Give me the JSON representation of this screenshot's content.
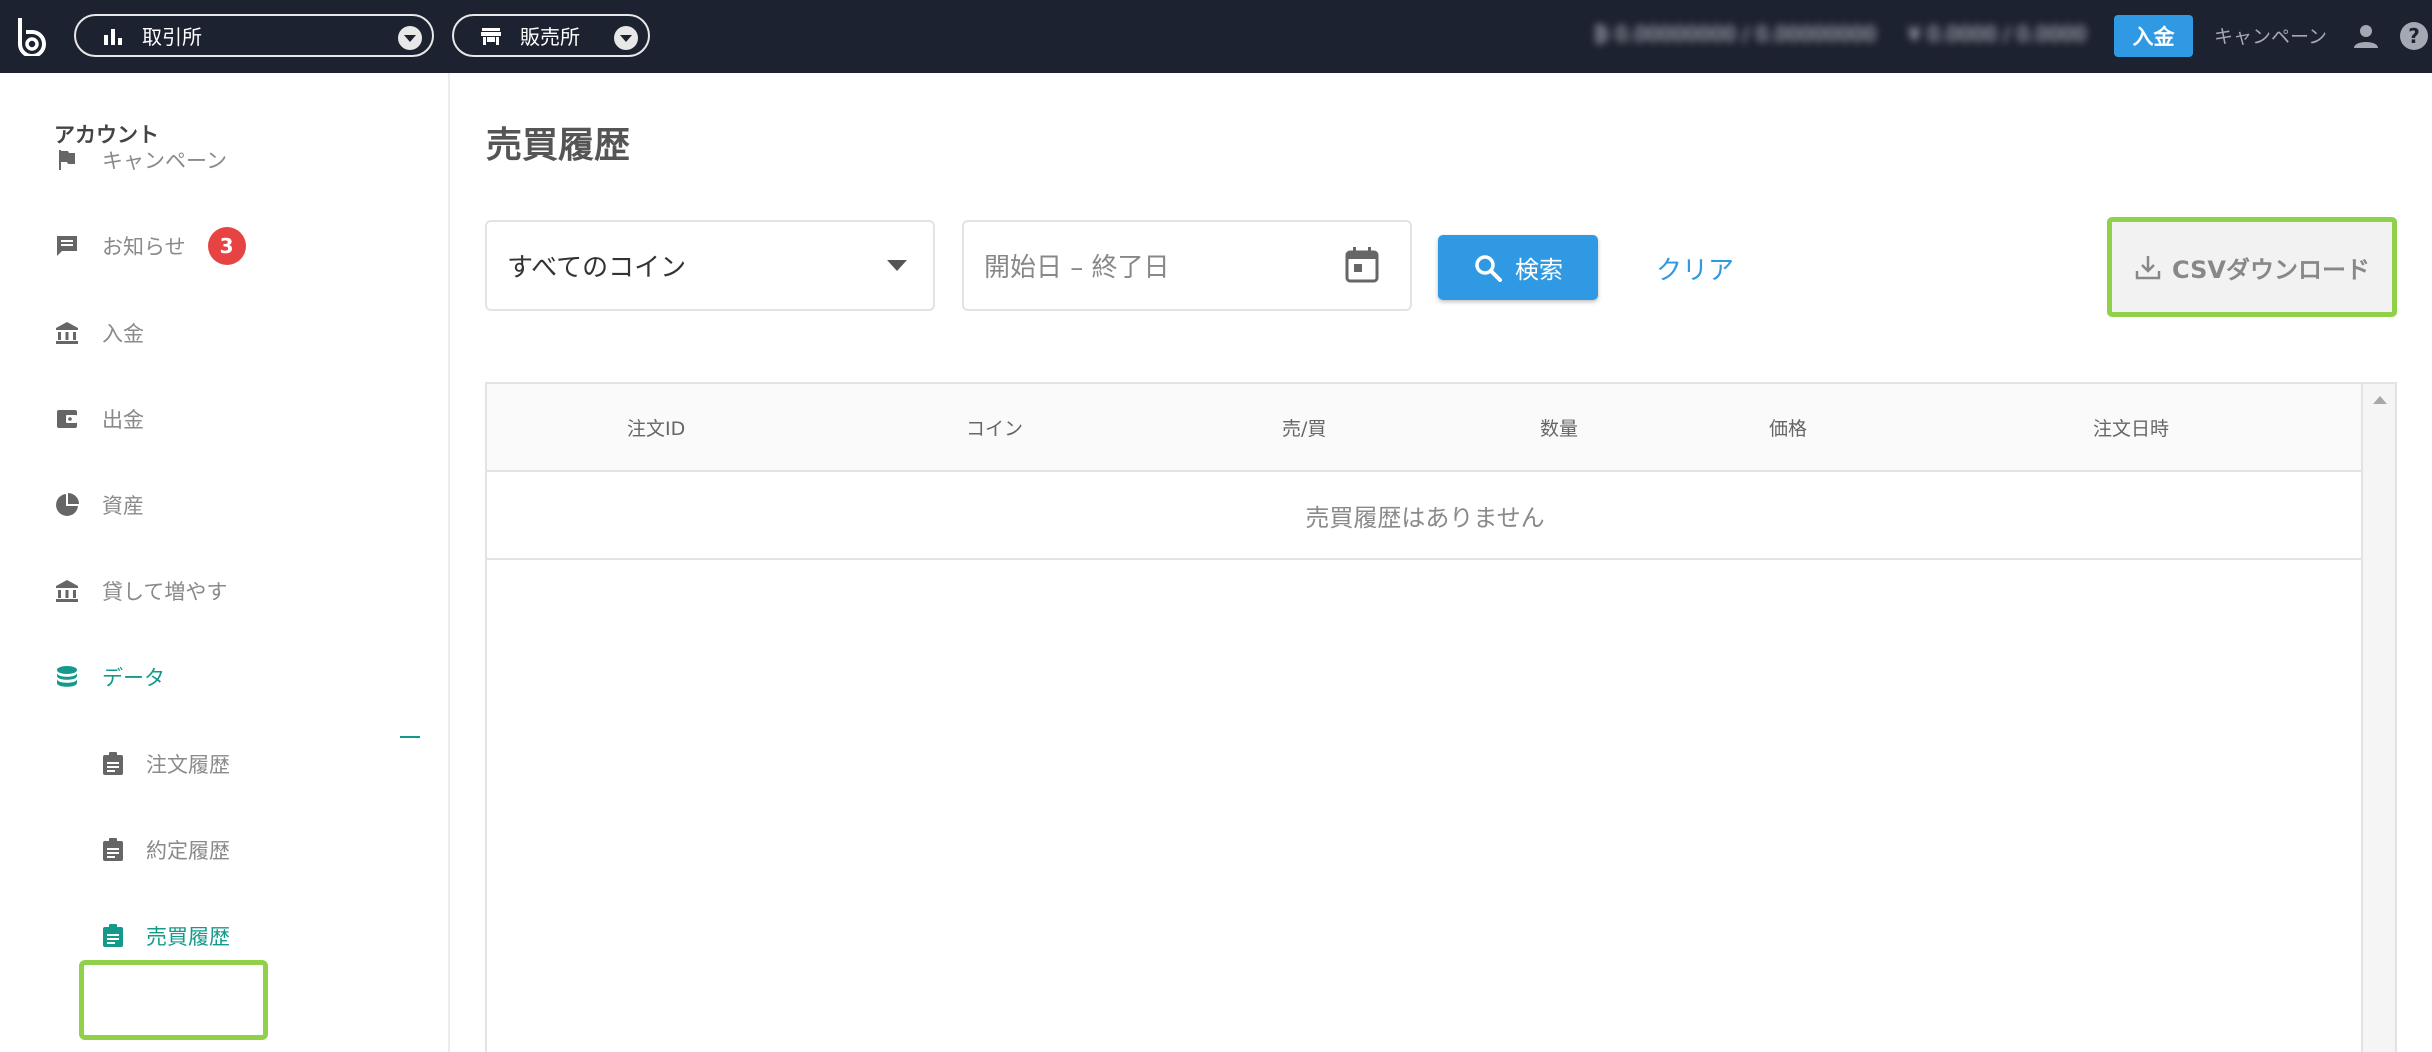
{
  "topbar": {
    "exchange_label": "取引所",
    "store_label": "販売所",
    "balance_btc": "₿ 0.00000000 / 0.00000000",
    "balance_yen": "¥ 0.0000 / 0.0000",
    "deposit_label": "入金",
    "campaign_label": "キャンペーン"
  },
  "sidebar": {
    "title": "アカウント",
    "items": [
      {
        "label": "キャンペーン",
        "icon": "flag-icon"
      },
      {
        "label": "お知らせ",
        "icon": "message-icon",
        "badge": "3"
      },
      {
        "label": "入金",
        "icon": "bank-icon"
      },
      {
        "label": "出金",
        "icon": "wallet-icon"
      },
      {
        "label": "資産",
        "icon": "pie-chart-icon"
      },
      {
        "label": "貸して増やす",
        "icon": "bank-icon"
      },
      {
        "label": "データ",
        "icon": "database-icon"
      }
    ],
    "sub_items": [
      {
        "label": "注文履歴",
        "icon": "clipboard-icon"
      },
      {
        "label": "約定履歴",
        "icon": "clipboard-icon"
      },
      {
        "label": "売買履歴",
        "icon": "clipboard-icon"
      }
    ]
  },
  "main": {
    "title": "売買履歴",
    "coin_select": "すべてのコイン",
    "date_range": "開始日 – 終了日",
    "search_label": "検索",
    "clear_label": "クリア",
    "csv_label": "CSVダウンロード",
    "table": {
      "columns": [
        "注文ID",
        "コイン",
        "売/買",
        "数量",
        "価格",
        "注文日時"
      ],
      "empty_message": "売買履歴はありません"
    }
  },
  "colors": {
    "topbar_bg": "#1d2230",
    "primary_blue": "#2f9ae3",
    "active_teal": "#139a8a",
    "highlight_green": "#8fd24a",
    "badge_red": "#e84343"
  }
}
